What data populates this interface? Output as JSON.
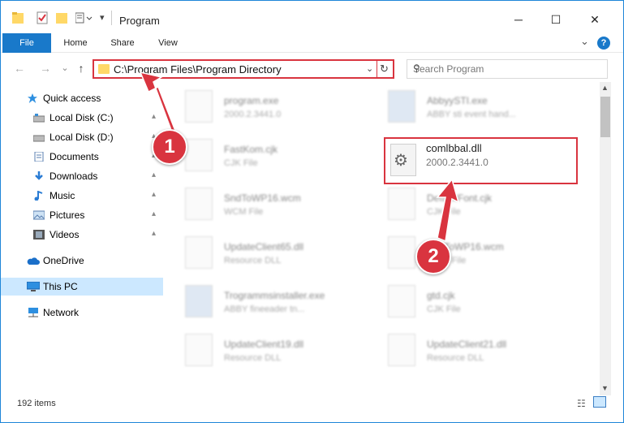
{
  "window": {
    "title": "Program",
    "minimize": "─",
    "maximize": "☐",
    "close": "✕"
  },
  "ribbon": {
    "tabs": [
      "File",
      "Home",
      "Share",
      "View"
    ],
    "collapse": "⌄",
    "help": "?"
  },
  "nav": {
    "back": "←",
    "forward": "→",
    "recent": "⌄",
    "up": "↑"
  },
  "address": {
    "path": "C:\\Program Files\\Program Directory",
    "dropdown": "⌄",
    "refresh": "↻"
  },
  "search": {
    "placeholder": "Search Program",
    "icon": "⚲"
  },
  "sidebar": {
    "items": [
      {
        "label": "Quick access",
        "icon": "star-icon"
      },
      {
        "label": "Local Disk (C:)",
        "icon": "drive-icon"
      },
      {
        "label": "Local Disk (D:)",
        "icon": "drive-icon"
      },
      {
        "label": "Documents",
        "icon": "documents-icon"
      },
      {
        "label": "Downloads",
        "icon": "download-icon"
      },
      {
        "label": "Music",
        "icon": "music-icon"
      },
      {
        "label": "Pictures",
        "icon": "pictures-icon"
      },
      {
        "label": "Videos",
        "icon": "video-icon"
      },
      {
        "label": "OneDrive",
        "icon": "cloud-icon"
      },
      {
        "label": "This PC",
        "icon": "pc-icon"
      },
      {
        "label": "Network",
        "icon": "network-icon"
      }
    ],
    "pin": "📌"
  },
  "files": [
    {
      "name": "program.exe",
      "meta": "2000.2.3441.0"
    },
    {
      "name": "AbbyySTI.exe",
      "meta": "ABBY sti event hand..."
    },
    {
      "name": "FastKom.cjk",
      "meta": "CJK File"
    },
    {
      "name": "SndToWP16.wcm",
      "meta": "WCM File"
    },
    {
      "name": "DefaultFont.cjk",
      "meta": "CJK File"
    },
    {
      "name": "UpdateClient65.dll",
      "meta": "Resource DLL"
    },
    {
      "name": "SndToWP16.wcm",
      "meta": "WCM File"
    },
    {
      "name": "Trogrammsinstaller.exe",
      "meta": "ABBY fineeader tn..."
    },
    {
      "name": "gtd.cjk",
      "meta": "CJK File"
    },
    {
      "name": "UpdateClient19.dll",
      "meta": "Resource DLL"
    },
    {
      "name": "UpdateClient21.dll",
      "meta": "Resource DLL"
    }
  ],
  "highlighted_file": {
    "name": "comlbbal.dll",
    "meta": "2000.2.3441.0",
    "icon": "gear-icon"
  },
  "badges": {
    "one": "1",
    "two": "2"
  },
  "status": {
    "count": "192 items"
  },
  "colors": {
    "accent": "#1979ca",
    "highlight": "#d9343f",
    "selected": "#cce8ff"
  }
}
